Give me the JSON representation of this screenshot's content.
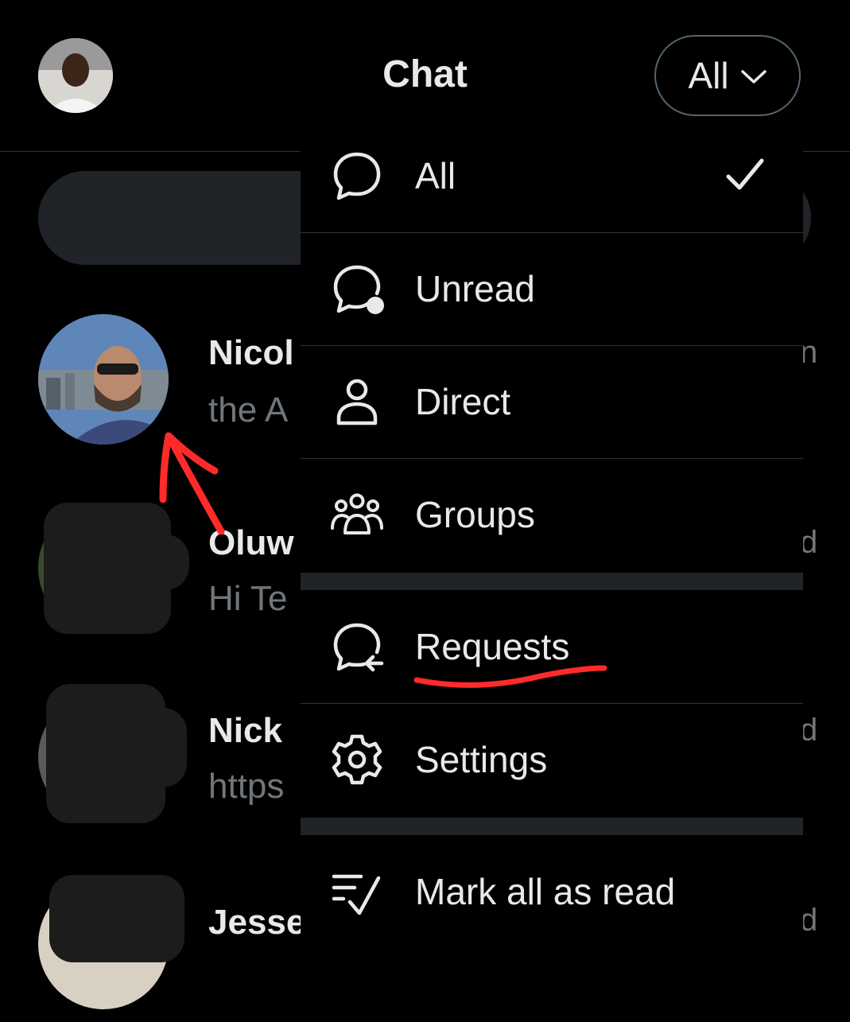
{
  "header": {
    "title": "Chat",
    "filter_label": "All"
  },
  "chats": [
    {
      "name": "Nicol",
      "preview": "the A",
      "time": "n"
    },
    {
      "name": "Oluw",
      "preview": "Hi Te",
      "time": "d"
    },
    {
      "name": "Nick",
      "preview": "https",
      "time": "d"
    },
    {
      "name": "Jesse",
      "preview": "",
      "time": "d"
    }
  ],
  "menu": {
    "items": [
      {
        "label": "All",
        "icon": "chat-bubble-icon",
        "checked": true
      },
      {
        "label": "Unread",
        "icon": "chat-bubble-unread-icon"
      },
      {
        "label": "Direct",
        "icon": "person-icon"
      },
      {
        "label": "Groups",
        "icon": "group-icon"
      },
      {
        "label": "Requests",
        "icon": "chat-request-icon"
      },
      {
        "label": "Settings",
        "icon": "gear-icon"
      },
      {
        "label": "Mark all as read",
        "icon": "mark-read-icon"
      }
    ]
  },
  "colors": {
    "background": "#000000",
    "text": "#e7e9ea",
    "secondary_text": "#71767b",
    "divider": "#2f3336",
    "annotation": "#ff2a2a"
  }
}
